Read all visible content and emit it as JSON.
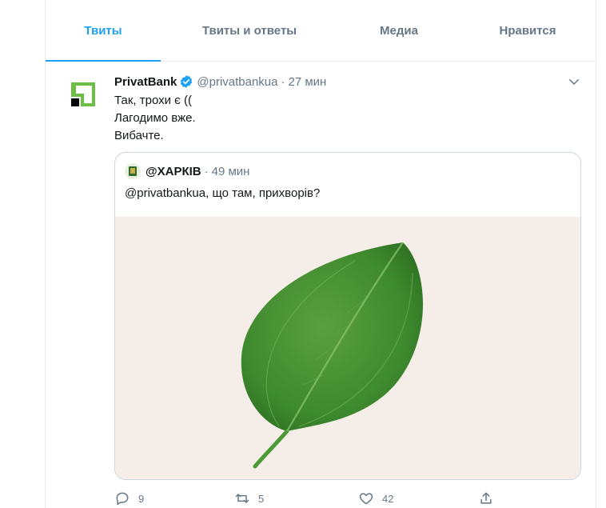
{
  "tabs": [
    {
      "label": "Твиты",
      "active": true
    },
    {
      "label": "Твиты и ответы",
      "active": false
    },
    {
      "label": "Медиа",
      "active": false
    },
    {
      "label": "Нравится",
      "active": false
    }
  ],
  "tweet": {
    "author_name": "PrivatBank",
    "author_handle": "@privatbankua",
    "separator": "·",
    "time": "27 мин",
    "lines": [
      "Так, трохи є ((",
      "Лагодимо вже.",
      "Вибачте."
    ],
    "quote": {
      "author_name": "@ХАРКІВ",
      "separator": "·",
      "time": "49 мин",
      "text": "@privatbankua, що там, прихворів?"
    },
    "actions": {
      "replies": "9",
      "retweets": "5",
      "likes": "42"
    }
  },
  "colors": {
    "accent": "#1da1f2",
    "brand_green": "#6cbe45",
    "muted": "#657786",
    "media_bg": "#f5eee8"
  },
  "icons": [
    "verified-badge-icon",
    "chevron-down-icon",
    "reply-icon",
    "retweet-icon",
    "like-icon",
    "share-icon"
  ]
}
